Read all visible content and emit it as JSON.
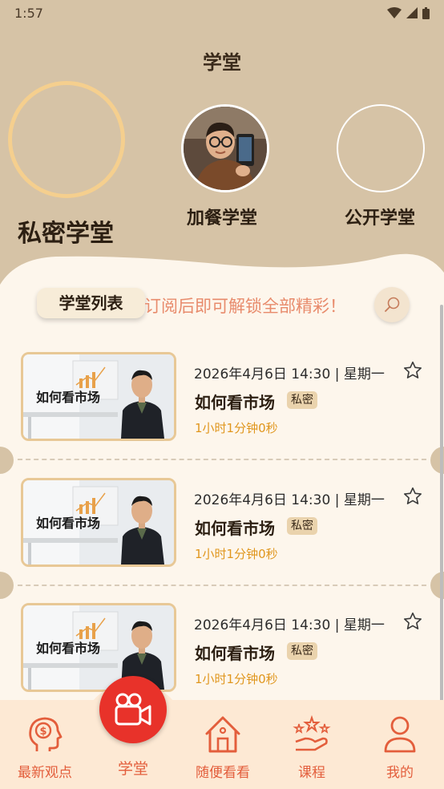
{
  "status": {
    "time": "1:57"
  },
  "header": {
    "title": "学堂"
  },
  "categories": [
    {
      "label": "私密学堂"
    },
    {
      "label": "加餐学堂"
    },
    {
      "label": "公开学堂"
    }
  ],
  "list": {
    "tab_label": "学堂列表",
    "notice": "订阅后即可解锁全部精彩！",
    "items": [
      {
        "thumb_title": "如何看市场",
        "date": "2026年4月6日 14:30 | 星期一",
        "title": "如何看市场",
        "badge": "私密",
        "duration": "1小时1分钟0秒"
      },
      {
        "thumb_title": "如何看市场",
        "date": "2026年4月6日 14:30 | 星期一",
        "title": "如何看市场",
        "badge": "私密",
        "duration": "1小时1分钟0秒"
      },
      {
        "thumb_title": "如何看市场",
        "date": "2026年4月6日 14:30 | 星期一",
        "title": "如何看市场",
        "badge": "私密",
        "duration": "1小时1分钟0秒"
      }
    ]
  },
  "nav": {
    "items": [
      {
        "label": "最新观点",
        "icon": "head-dollar-icon"
      },
      {
        "label": "学堂",
        "icon": "video-camera-icon"
      },
      {
        "label": "随便看看",
        "icon": "house-icon"
      },
      {
        "label": "课程",
        "icon": "hand-stars-icon"
      },
      {
        "label": "我的",
        "icon": "person-icon"
      }
    ]
  },
  "colors": {
    "accent": "#e35e3c",
    "background": "#d6c3a6",
    "panel": "#fdf6ec",
    "gold": "#e0961d"
  }
}
